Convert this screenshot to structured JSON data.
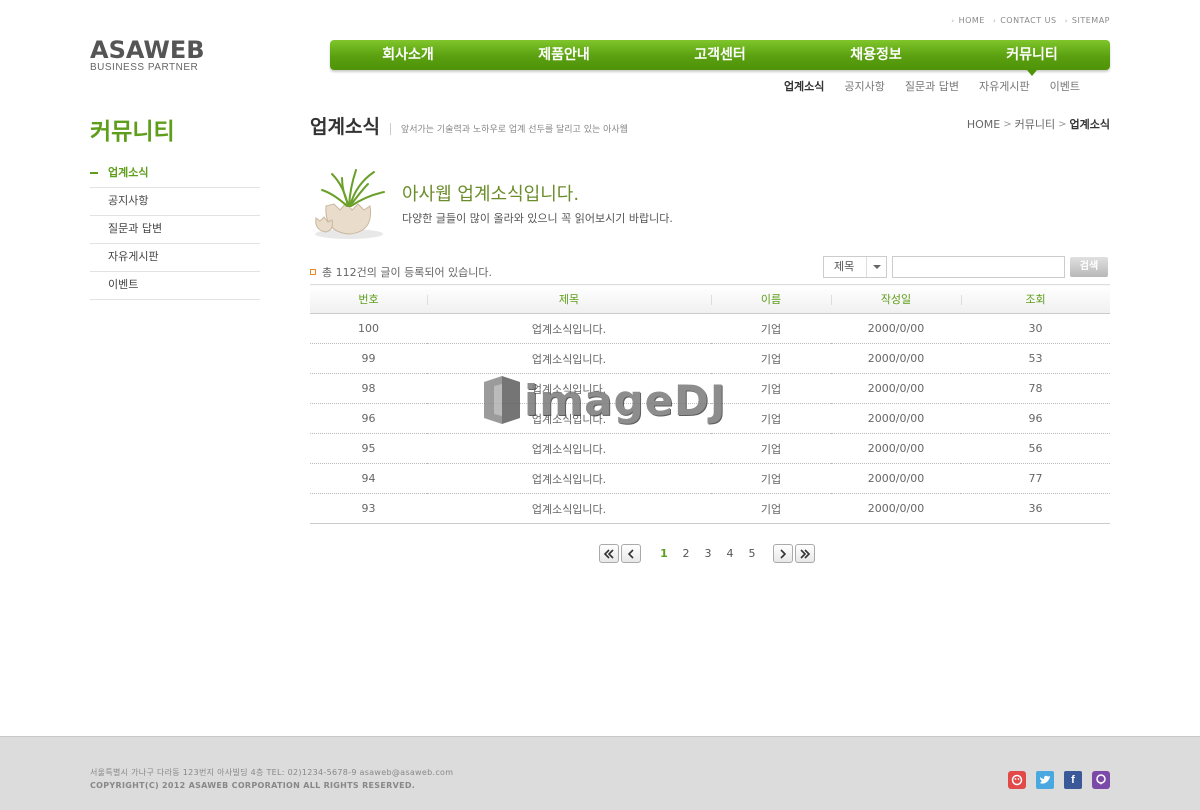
{
  "util_links": [
    "HOME",
    "CONTACT US",
    "SITEMAP"
  ],
  "logo": {
    "main": "ASAWEB",
    "sub": "BUSINESS PARTNER"
  },
  "gnb": [
    "회사소개",
    "제품안내",
    "고객센터",
    "채용정보",
    "커뮤니티"
  ],
  "lnb": [
    "업계소식",
    "공지사항",
    "질문과 답변",
    "자유게시판",
    "이벤트"
  ],
  "sidebar": {
    "title": "커뮤니티",
    "items": [
      "업계소식",
      "공지사항",
      "질문과 답변",
      "자유게시판",
      "이벤트"
    ]
  },
  "page": {
    "title": "업계소식",
    "desc": "앞서가는 기술력과 노하우로 업계 선두를 달리고 있는 아사웹",
    "breadcrumb": [
      "HOME",
      "커뮤니티",
      "업계소식"
    ]
  },
  "intro": {
    "title": "아사웹 업계소식입니다.",
    "desc": "다양한 글들이 많이 올라와 있으니 꼭 읽어보시기 바랍니다."
  },
  "count_text": "총 112건의 글이 등록되어 있습니다.",
  "search": {
    "select": "제목",
    "input": "",
    "button": "검색"
  },
  "table": {
    "headers": [
      "번호",
      "제목",
      "이름",
      "작성일",
      "조회"
    ],
    "rows": [
      [
        "100",
        "업계소식입니다.",
        "기업",
        "2000/0/00",
        "30"
      ],
      [
        "99",
        "업계소식입니다.",
        "기업",
        "2000/0/00",
        "53"
      ],
      [
        "98",
        "업계소식입니다.",
        "기업",
        "2000/0/00",
        "78"
      ],
      [
        "96",
        "업계소식입니다.",
        "기업",
        "2000/0/00",
        "96"
      ],
      [
        "95",
        "업계소식입니다.",
        "기업",
        "2000/0/00",
        "56"
      ],
      [
        "94",
        "업계소식입니다.",
        "기업",
        "2000/0/00",
        "77"
      ],
      [
        "93",
        "업계소식입니다.",
        "기업",
        "2000/0/00",
        "36"
      ]
    ]
  },
  "paging": {
    "pages": [
      "1",
      "2",
      "3",
      "4",
      "5"
    ],
    "current": "1"
  },
  "watermark": "imageDJ",
  "footer": {
    "address": "서울특별시 가나구 다라동 123번지 아사빌딩 4층    TEL: 02)1234-5678-9    asaweb@asaweb.com",
    "copyright": "COPYRIGHT(C) 2012 ASAWEB CORPORATION ALL RIGHTS RESERVED.",
    "sns": [
      {
        "icon": "cyworld-icon",
        "color": "#e24a4a"
      },
      {
        "icon": "twitter-icon",
        "color": "#4aa8e0"
      },
      {
        "icon": "facebook-icon",
        "color": "#3b5998"
      },
      {
        "icon": "me2day-icon",
        "color": "#7b4aa8"
      }
    ]
  }
}
